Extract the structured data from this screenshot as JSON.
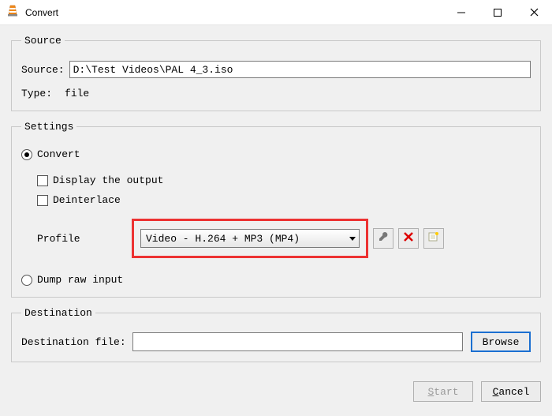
{
  "window": {
    "title": "Convert"
  },
  "source": {
    "legend": "Source",
    "source_label": "Source:",
    "source_value": "D:\\Test Videos\\PAL 4_3.iso",
    "type_label": "Type:",
    "type_value": "file"
  },
  "settings": {
    "legend": "Settings",
    "convert_label": "Convert",
    "display_output_label": "Display the output",
    "deinterlace_label": "Deinterlace",
    "profile_label": "Profile",
    "profile_value": "Video - H.264 + MP3 (MP4)",
    "dump_label": "Dump raw input"
  },
  "destination": {
    "legend": "Destination",
    "file_label": "Destination file:",
    "file_value": "",
    "browse_label": "Browse"
  },
  "actions": {
    "start": "Start",
    "cancel": "Cancel"
  }
}
